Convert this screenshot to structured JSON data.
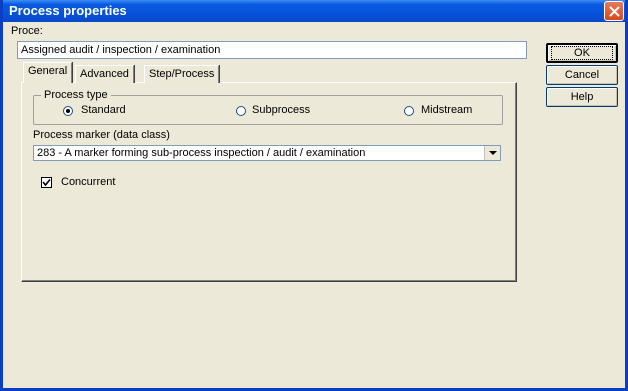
{
  "window": {
    "title": "Process properties"
  },
  "process": {
    "label": "Proce:",
    "value": "Assigned audit / inspection / examination"
  },
  "buttons": {
    "ok": "OK",
    "cancel": "Cancel",
    "help": "Help"
  },
  "tabs": [
    {
      "label": "General",
      "active": true
    },
    {
      "label": "Advanced",
      "active": false
    },
    {
      "label": "Step/Process",
      "active": false
    }
  ],
  "process_type": {
    "legend": "Process type",
    "options": [
      {
        "label": "Standard",
        "checked": true
      },
      {
        "label": "Subprocess",
        "checked": false
      },
      {
        "label": "Midstream",
        "checked": false
      }
    ]
  },
  "marker": {
    "label": "Process marker (data class)",
    "selected": "283 - A marker forming sub-process inspection / audit / examination"
  },
  "concurrent": {
    "label": "Concurrent",
    "checked": true
  },
  "icons": {
    "close": "close-icon",
    "dropdown": "chevron-down-icon",
    "check": "check-icon"
  },
  "colors": {
    "titlebar": "#0553da",
    "dialog_bg": "#ece9d8",
    "close_button": "#d9481f"
  }
}
